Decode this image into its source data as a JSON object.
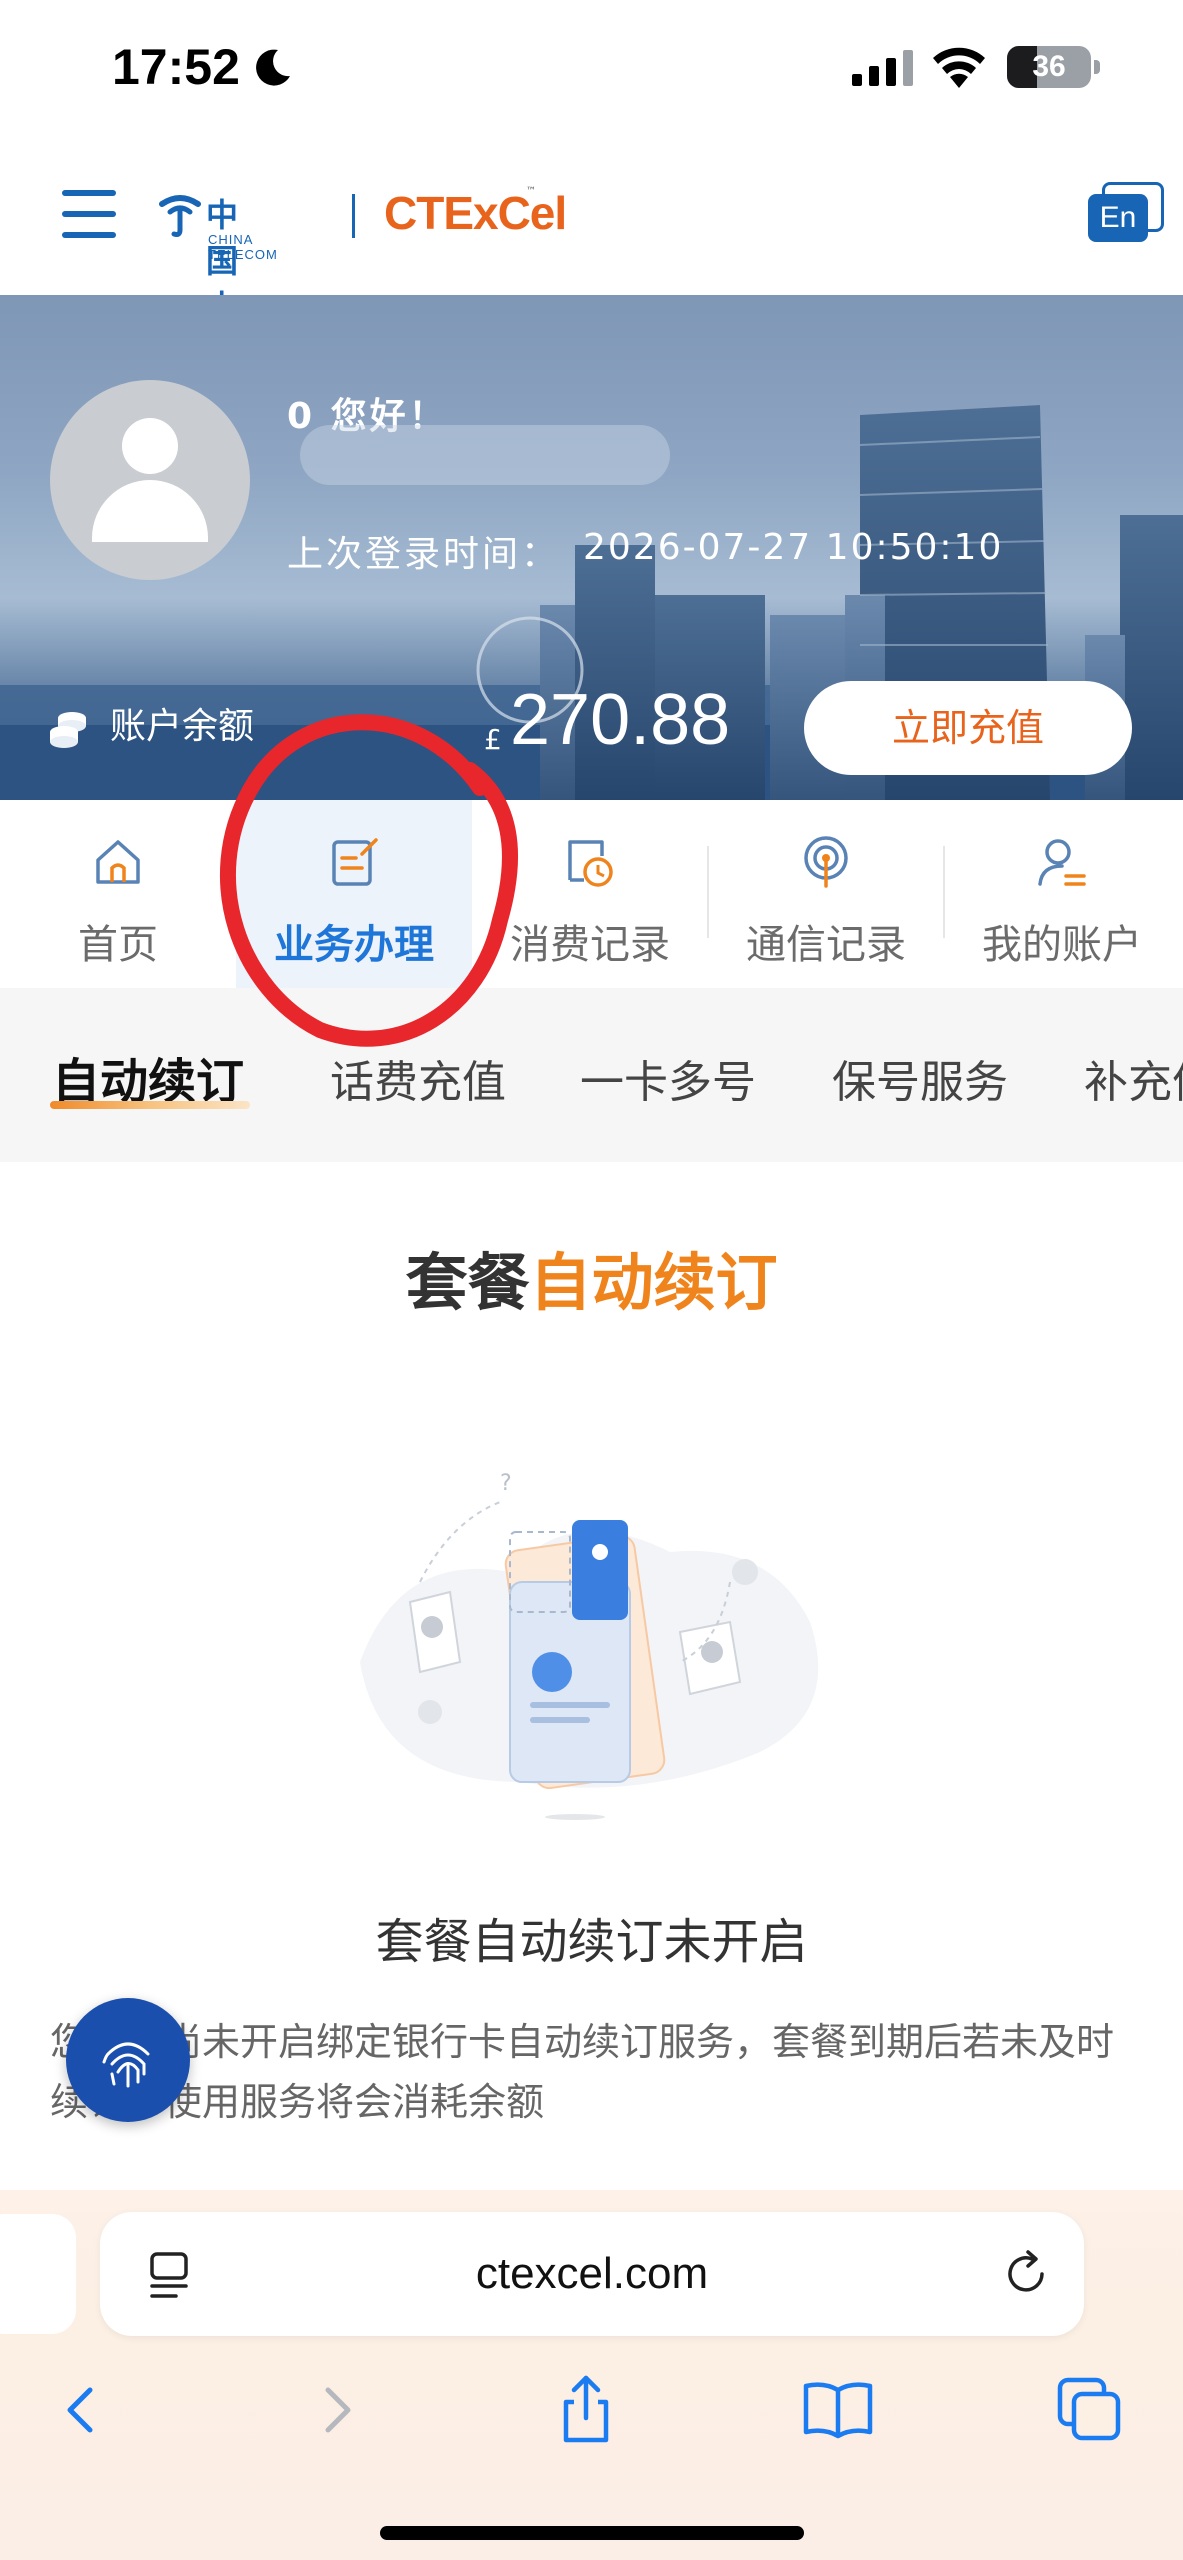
{
  "status_bar": {
    "time": "17:52",
    "battery": "36",
    "battery_level": 0.36
  },
  "header": {
    "logo_cn": "中国电信",
    "logo_en": "CHINA TELECOM",
    "logo_brand": "CTExCel",
    "language_button": "En"
  },
  "banner": {
    "greeting": "0 您好！",
    "last_login_label": "上次登录时间：",
    "last_login_value": "2026-07-27 10:50:10",
    "balance_label": "账户余额",
    "currency": "£",
    "balance": "270.88",
    "recharge_label": "立即充值"
  },
  "main_nav": {
    "items": [
      {
        "label": "首页",
        "icon": "home-icon"
      },
      {
        "label": "业务办理",
        "icon": "edit-document-icon",
        "active": true
      },
      {
        "label": "消费记录",
        "icon": "bill-clock-icon"
      },
      {
        "label": "通信记录",
        "icon": "signal-location-icon"
      },
      {
        "label": "我的账户",
        "icon": "user-account-icon"
      }
    ]
  },
  "sub_tabs": {
    "items": [
      "自动续订",
      "话费充值",
      "一卡多号",
      "保号服务",
      "补充值"
    ],
    "active": "自动续订"
  },
  "content": {
    "title_prefix": "套餐",
    "title_accent": "自动续订",
    "empty_title": "套餐自动续订未开启",
    "empty_desc": "您当前尚未开启绑定银行卡自动续订服务，套餐到期后若未及时续订，使用服务将会消耗余额"
  },
  "browser": {
    "url": "ctexcel.com"
  },
  "colors": {
    "brand_blue": "#1765b4",
    "accent_orange": "#f0841c",
    "active_nav": "#1e76d8",
    "annotation_red": "#e8272c"
  }
}
